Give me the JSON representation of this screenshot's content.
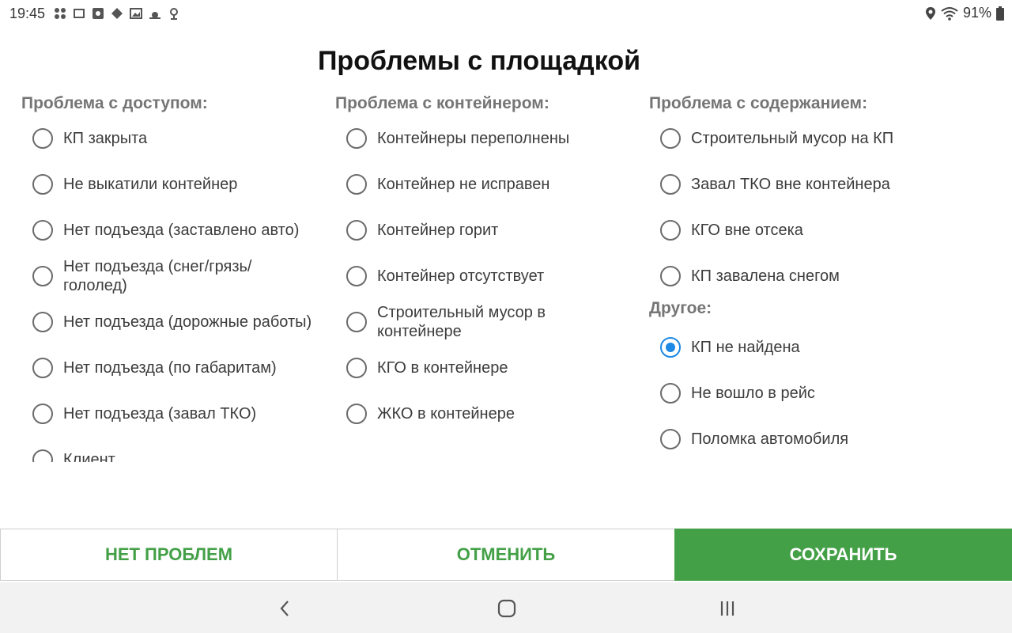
{
  "status_bar": {
    "time": "19:45",
    "battery": "91%",
    "left_icons": [
      "apps-icon",
      "notification-icon",
      "square-app-icon",
      "diamond-icon",
      "image-icon",
      "weather-icon",
      "location-pin-icon"
    ],
    "right_icons": [
      "location-icon",
      "wifi-icon",
      "battery-icon"
    ]
  },
  "dialog": {
    "title": "Проблемы с площадкой",
    "columns": [
      {
        "header": "Проблема с доступом:",
        "options": [
          {
            "label": "КП закрыта",
            "selected": false
          },
          {
            "label": "Не выкатили контейнер",
            "selected": false
          },
          {
            "label": "Нет подъезда (заставлено авто)",
            "selected": false
          },
          {
            "label": "Нет подъезда (снег/грязь/гололед)",
            "selected": false
          },
          {
            "label": "Нет подъезда (дорожные работы)",
            "selected": false
          },
          {
            "label": "Нет подъезда (по габаритам)",
            "selected": false
          },
          {
            "label": "Нет подъезда (завал ТКО)",
            "selected": false
          },
          {
            "label": "Клиент",
            "selected": false
          }
        ]
      },
      {
        "header": "Проблема с контейнером:",
        "options": [
          {
            "label": "Контейнеры переполнены",
            "selected": false
          },
          {
            "label": "Контейнер не исправен",
            "selected": false
          },
          {
            "label": "Контейнер горит",
            "selected": false
          },
          {
            "label": "Контейнер отсутствует",
            "selected": false
          },
          {
            "label": "Строительный мусор в контейнере",
            "selected": false
          },
          {
            "label": "КГО в контейнере",
            "selected": false
          },
          {
            "label": "ЖКО в контейнере",
            "selected": false
          }
        ]
      },
      {
        "header": "Проблема с содержанием:",
        "options": [
          {
            "label": "Строительный мусор на КП",
            "selected": false
          },
          {
            "label": "Завал ТКО вне контейнера",
            "selected": false
          },
          {
            "label": "КГО вне отсека",
            "selected": false
          },
          {
            "label": "КП завалена снегом",
            "selected": false
          }
        ],
        "other_header": "Другое:",
        "other_options": [
          {
            "label": "КП не найдена",
            "selected": true
          },
          {
            "label": "Не вошло в рейс",
            "selected": false
          },
          {
            "label": "Поломка автомобиля",
            "selected": false
          }
        ]
      }
    ],
    "buttons": {
      "no_problems": "НЕТ ПРОБЛЕМ",
      "cancel": "ОТМЕНИТЬ",
      "save": "СОХРАНИТЬ"
    }
  },
  "colors": {
    "accent_green": "#43a047",
    "radio_selected": "#1e88e5",
    "header_gray": "#757575"
  }
}
